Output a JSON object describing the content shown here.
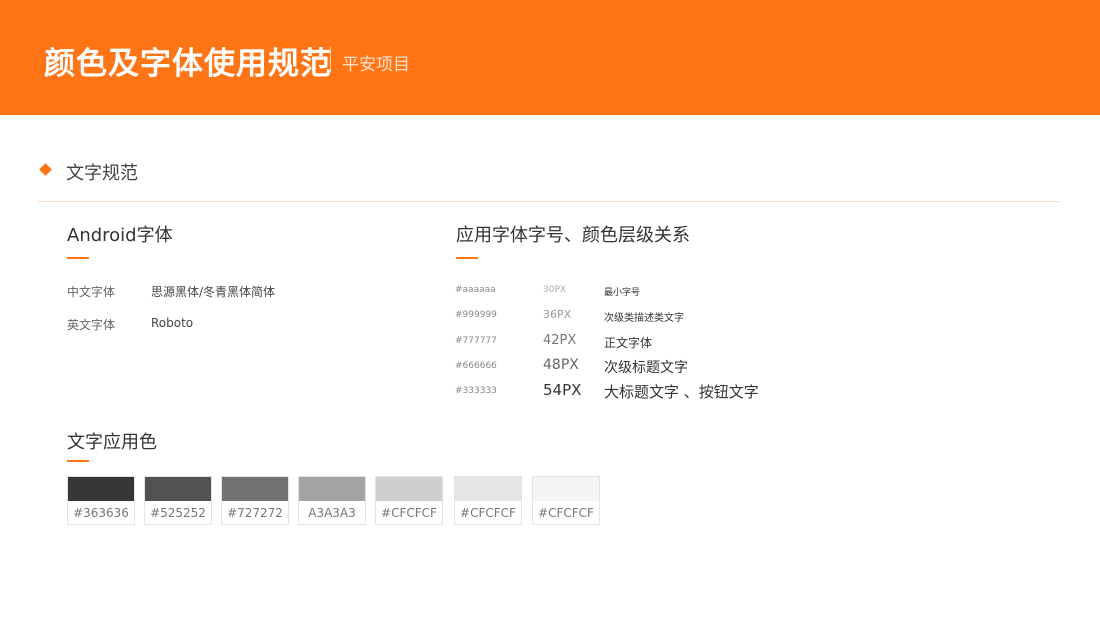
{
  "header": {
    "title": "颜色及字体使用规范",
    "subtitle": "平安项目"
  },
  "section": {
    "label": "文字规范"
  },
  "android": {
    "title": "Android字体",
    "rows": [
      {
        "key": "中文字体",
        "value": "思源黑体/冬青黑体简体"
      },
      {
        "key": "英文字体",
        "value": "Roboto"
      }
    ]
  },
  "scale": {
    "title": "应用字体字号、颜色层级关系",
    "rows": [
      {
        "hex": "#aaaaaa",
        "size": "30PX",
        "desc": "最小字号",
        "color": "#aaaaaa"
      },
      {
        "hex": "#999999",
        "size": "36PX",
        "desc": "次级类描述类文字",
        "color": "#999999"
      },
      {
        "hex": "#777777",
        "size": "42PX",
        "desc": "正文字体",
        "color": "#777777"
      },
      {
        "hex": "#666666",
        "size": "48PX",
        "desc": "次级标题文字",
        "color": "#666666"
      },
      {
        "hex": "#333333",
        "size": "54PX",
        "desc": "大标题文字 、按钮文字",
        "color": "#333333"
      }
    ]
  },
  "palette": {
    "title": "文字应用色",
    "swatches": [
      {
        "label": "#363636",
        "color": "#363636"
      },
      {
        "label": "#525252",
        "color": "#525252"
      },
      {
        "label": "#727272",
        "color": "#727272"
      },
      {
        "label": "A3A3A3",
        "color": "#a3a3a3"
      },
      {
        "label": "#CFCFCF",
        "color": "#cfcfcf"
      },
      {
        "label": "#CFCFCF",
        "color": "#e6e6e6"
      },
      {
        "label": "#CFCFCF",
        "color": "#f4f4f4"
      }
    ]
  },
  "accent_color": "#ff7415"
}
